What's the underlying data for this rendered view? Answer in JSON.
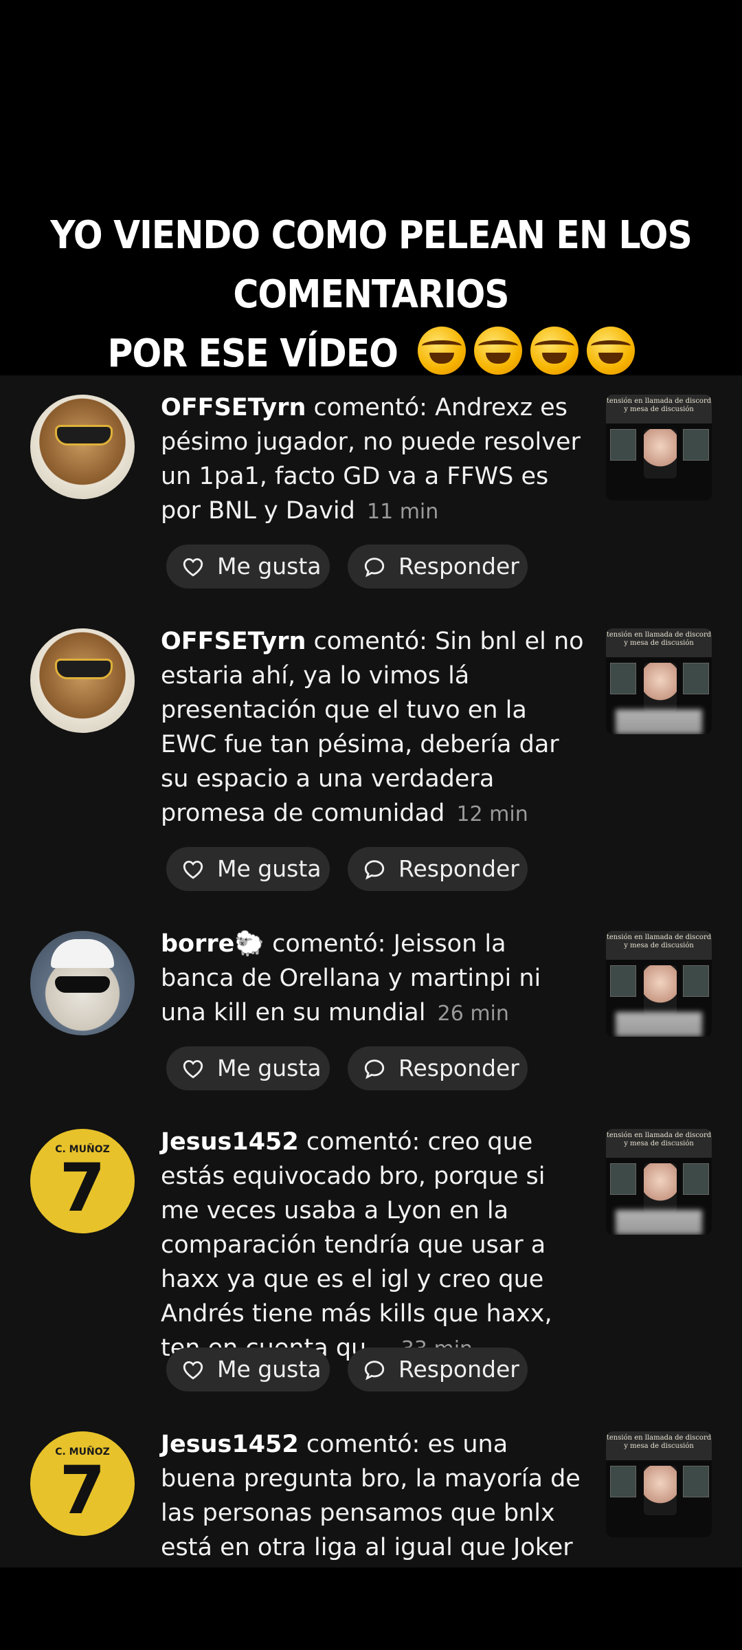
{
  "caption": {
    "line1": "YO VIENDO COMO PELEAN EN LOS COMENTARIOS",
    "line2": "POR ESE VÍDEO"
  },
  "actions": {
    "like_label": "Me gusta",
    "reply_label": "Responder"
  },
  "comments": [
    {
      "user": "OFFSETyrn",
      "verb": "comentó:",
      "text": "Andrexz es pésimo jugador, no puede resolver un 1pa1, facto GD va a FFWS es por BNL y David",
      "time": "11 min"
    },
    {
      "user": "OFFSETyrn",
      "verb": "comentó:",
      "text": "Sin bnl el no estaria ahí, ya lo vimos lá presentación que el tuvo en la EWC fue tan pésima, debería dar su espacio a una verdadera promesa de comunidad",
      "time": "12 min"
    },
    {
      "user": "borre🐑",
      "verb": "comentó:",
      "text": "Jeisson la banca de Orellana y martinpi ni una kill en su mundial",
      "time": "26 min"
    },
    {
      "user": "Jesus1452",
      "verb": "comentó:",
      "text": "creo que estás equivocado bro, porque si me veces usaba a Lyon en la comparación tendría que usar a haxx ya que es el igl y creo que Andrés tiene más kills que haxx, ten en cuenta qu...",
      "time": "33 min"
    },
    {
      "user": "Jesus1452",
      "verb": "comentó:",
      "text": "es una buena pregunta bro, la mayoría de las personas pensamos que bnlx está en otra liga al igual que Joker y Gamez",
      "time": ""
    }
  ],
  "avatar": {
    "jersey_name": "C. MUÑOZ",
    "jersey_number": "7"
  },
  "thumbnail": {
    "banner_text": "tensión en llamada de discord y mesa de discusión"
  }
}
